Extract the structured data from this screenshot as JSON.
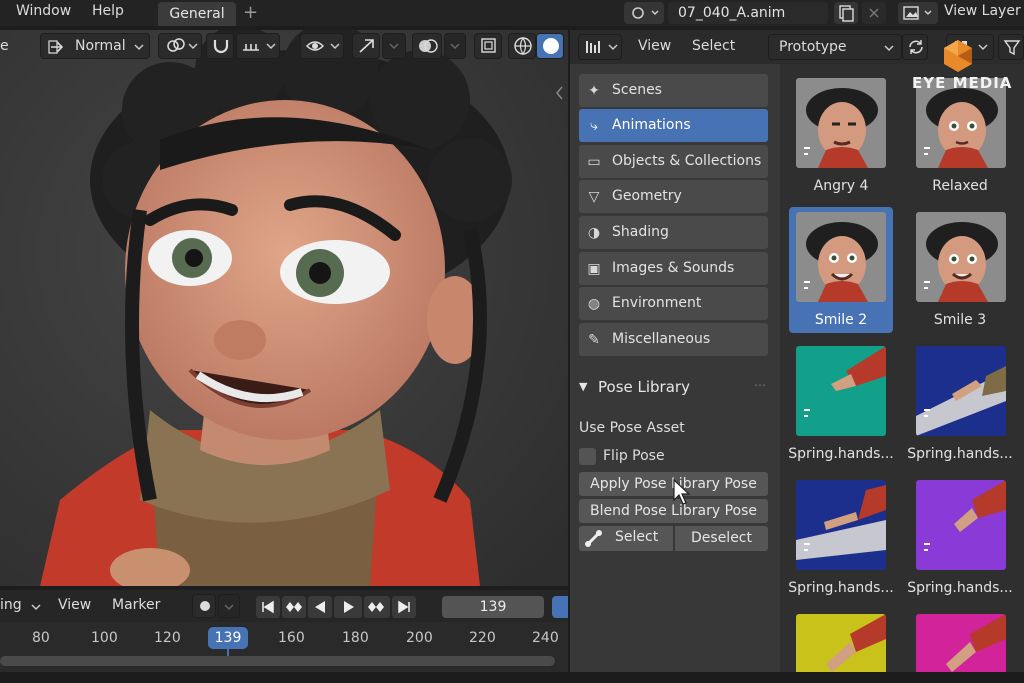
{
  "topbar": {
    "menus": [
      "Window",
      "Help"
    ],
    "workspace_tab": "General",
    "add_tab": "+",
    "filename": "07_040_A.anim",
    "view_layer": "View Layer"
  },
  "viewport": {
    "mode_label": "Normal",
    "left_edge": "e"
  },
  "timeline": {
    "mode_label": "ing",
    "menu_view": "View",
    "menu_marker": "Marker",
    "current_frame": "139",
    "ticks": [
      "80",
      "100",
      "120",
      "139",
      "160",
      "180",
      "200",
      "220",
      "240"
    ]
  },
  "asset_browser": {
    "menu_view": "View",
    "menu_select": "Select",
    "library": "Prototype",
    "categories": [
      {
        "label": "Scenes",
        "icon": "scenes-icon",
        "active": false
      },
      {
        "label": "Animations",
        "icon": "animation-icon",
        "active": true
      },
      {
        "label": "Objects & Collections",
        "icon": "collection-icon",
        "active": false
      },
      {
        "label": "Geometry",
        "icon": "geometry-icon",
        "active": false
      },
      {
        "label": "Shading",
        "icon": "shading-icon",
        "active": false
      },
      {
        "label": "Images & Sounds",
        "icon": "image-icon",
        "active": false
      },
      {
        "label": "Environment",
        "icon": "world-icon",
        "active": false
      },
      {
        "label": "Miscellaneous",
        "icon": "pencil-icon",
        "active": false
      }
    ],
    "pose_library": {
      "title": "Pose Library",
      "use_pose_asset": "Use Pose Asset",
      "flip_pose": "Flip Pose",
      "apply": "Apply Pose Library Pose",
      "blend": "Blend Pose Library Pose",
      "select": "Select",
      "deselect": "Deselect"
    },
    "assets": [
      {
        "label": "Angry 4",
        "kind": "face",
        "bg": "#8a8a8a",
        "selected": false
      },
      {
        "label": "Relaxed",
        "kind": "face",
        "bg": "#8a8a8a",
        "selected": false
      },
      {
        "label": "Smile 2",
        "kind": "face",
        "bg": "#8a8a8a",
        "selected": true
      },
      {
        "label": "Smile 3",
        "kind": "face",
        "bg": "#8a8a8a",
        "selected": false
      },
      {
        "label": "Spring.hands...",
        "kind": "hand",
        "bg": "#13a08a",
        "selected": false
      },
      {
        "label": "Spring.hands...",
        "kind": "hand",
        "bg": "#1c2f8c",
        "selected": false
      },
      {
        "label": "Spring.hands...",
        "kind": "hand",
        "bg": "#1c2f8c",
        "selected": false
      },
      {
        "label": "Spring.hands...",
        "kind": "hand",
        "bg": "#8a3ad6",
        "selected": false
      },
      {
        "label": "",
        "kind": "hand",
        "bg": "#c9c21a",
        "selected": false
      },
      {
        "label": "",
        "kind": "hand",
        "bg": "#d2239a",
        "selected": false
      }
    ]
  },
  "watermark": {
    "text": "EYE MEDIA"
  },
  "colors": {
    "accent": "#4772b3",
    "panel": "#383838",
    "header": "#2b2b2b"
  }
}
